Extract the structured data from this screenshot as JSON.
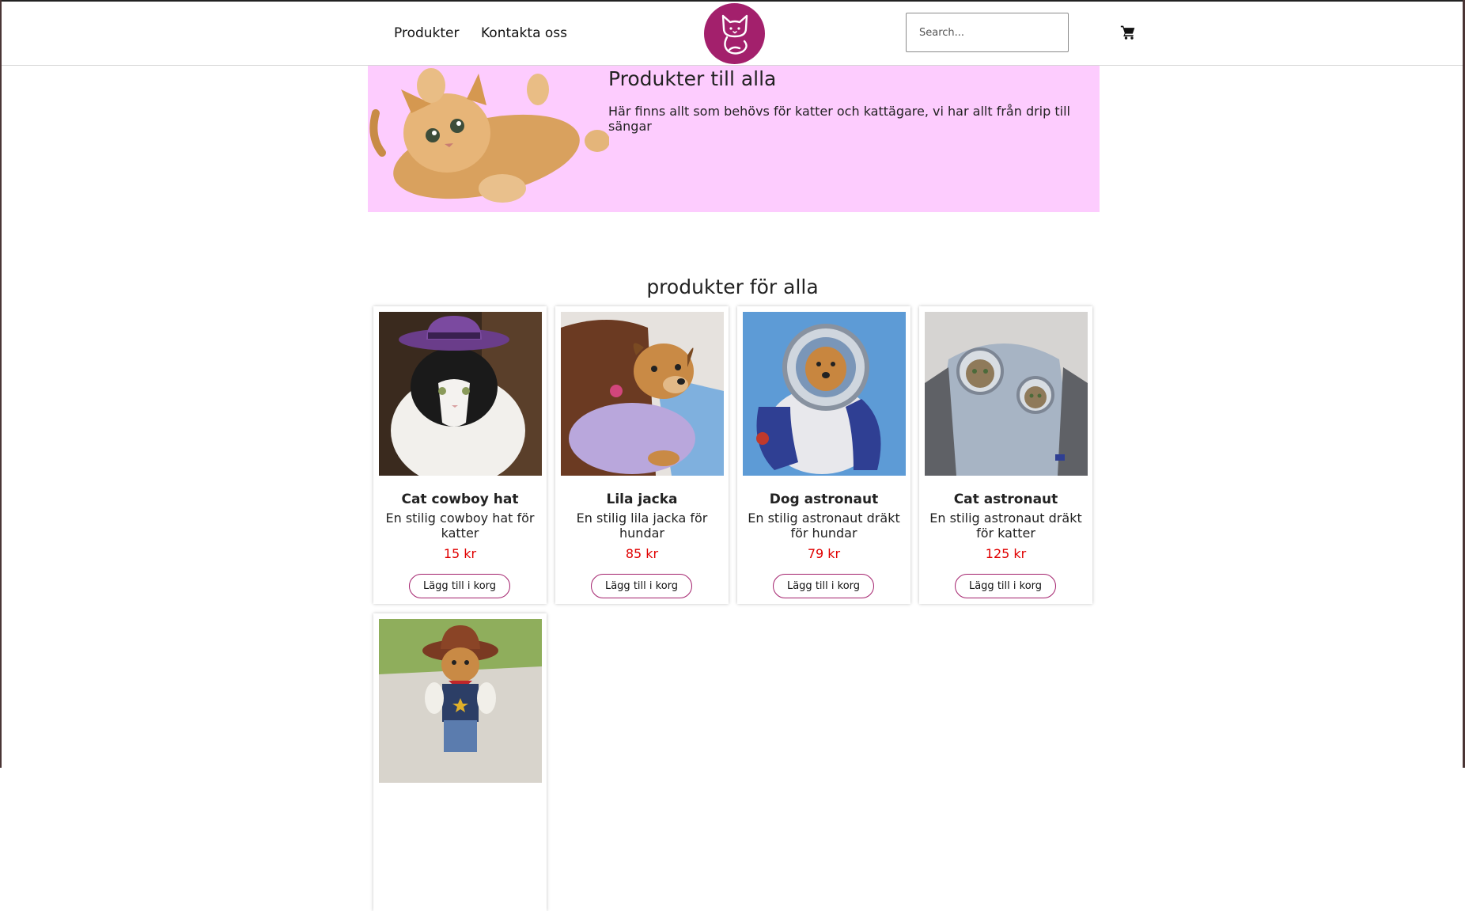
{
  "header": {
    "nav": [
      "Produkter",
      "Kontakta oss"
    ],
    "search_placeholder": "Search...",
    "logo_icon": "cat-logo-icon",
    "cart_icon": "shopping-cart-icon",
    "brand_color": "#a3206c"
  },
  "hero": {
    "title": "Produkter till alla",
    "text": "Här finns allt som behövs för katter och kattägare, vi har allt från drip till sängar",
    "background": "#fdccfe"
  },
  "products_section": {
    "title": "produkter för alla",
    "items": [
      {
        "name": "Cat cowboy hat",
        "description": "En stilig cowboy hat för katter",
        "price": "15 kr",
        "button": "Lägg till i korg"
      },
      {
        "name": "Lila jacka",
        "description": "En stilig lila jacka för hundar",
        "price": "85 kr",
        "button": "Lägg till i korg"
      },
      {
        "name": "Dog astronaut",
        "description": "En stilig astronaut dräkt för hundar",
        "price": "79 kr",
        "button": "Lägg till i korg"
      },
      {
        "name": "Cat astronaut",
        "description": "En stilig astronaut dräkt för katter",
        "price": "125 kr",
        "button": "Lägg till i korg"
      },
      {
        "name": "",
        "description": "",
        "price": "",
        "button": ""
      }
    ]
  },
  "price_color": "#e00000"
}
